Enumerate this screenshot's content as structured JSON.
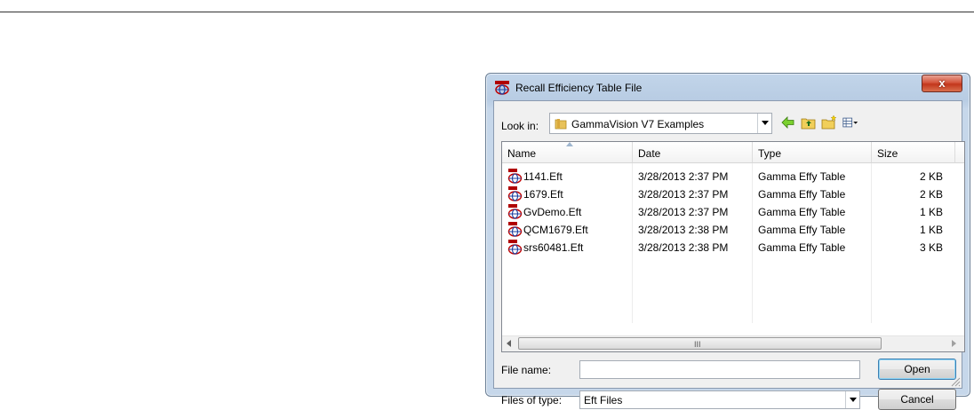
{
  "dialog": {
    "title": "Recall Efficiency Table File",
    "close_label": "x"
  },
  "lookin": {
    "label": "Look in:",
    "value": "GammaVision V7 Examples"
  },
  "columns": [
    "Name",
    "Date",
    "Type",
    "Size"
  ],
  "files": [
    {
      "name": "1141.Eft",
      "date": "3/28/2013 2:37 PM",
      "type": "Gamma Effy Table",
      "size": "2 KB"
    },
    {
      "name": "1679.Eft",
      "date": "3/28/2013 2:37 PM",
      "type": "Gamma Effy Table",
      "size": "2 KB"
    },
    {
      "name": "GvDemo.Eft",
      "date": "3/28/2013 2:37 PM",
      "type": "Gamma Effy Table",
      "size": "1 KB"
    },
    {
      "name": "QCM1679.Eft",
      "date": "3/28/2013 2:38 PM",
      "type": "Gamma Effy Table",
      "size": "1 KB"
    },
    {
      "name": "srs60481.Eft",
      "date": "3/28/2013 2:38 PM",
      "type": "Gamma Effy Table",
      "size": "3 KB"
    }
  ],
  "scroll_grip": "III",
  "filename": {
    "label": "File name:",
    "value": ""
  },
  "filetype": {
    "label": "Files of type:",
    "value": "Eft Files"
  },
  "buttons": {
    "open": "Open",
    "cancel": "Cancel"
  },
  "colors": {
    "close_button": "#c3361b",
    "title_gradient": "#c2d5ea"
  }
}
